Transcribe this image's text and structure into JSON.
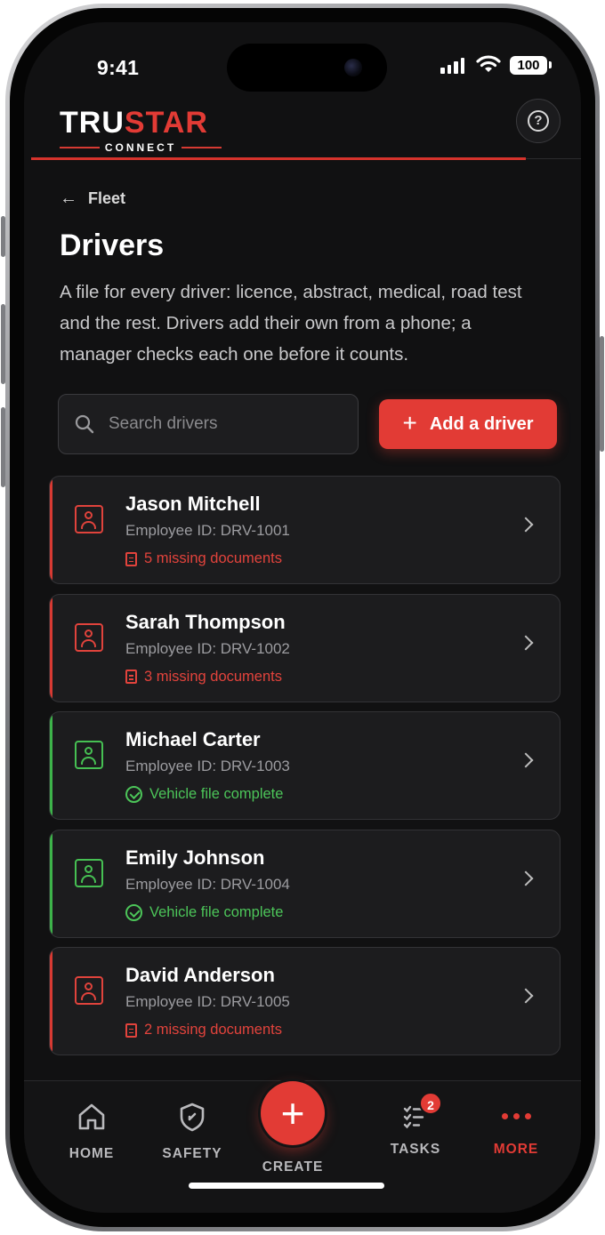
{
  "status_bar": {
    "time": "9:41",
    "battery": "100"
  },
  "brand": {
    "name_white": "TRU",
    "name_red": "STAR",
    "sub": "CONNECT"
  },
  "header": {
    "help_label": "?"
  },
  "breadcrumb": {
    "back_label": "Fleet"
  },
  "page": {
    "title": "Drivers",
    "description": "A file for every driver: licence, abstract, medical, road test and the rest. Drivers add their own from a phone; a manager checks each one before it counts."
  },
  "search": {
    "placeholder": "Search drivers",
    "value": ""
  },
  "actions": {
    "add_driver_label": "Add a driver"
  },
  "drivers": [
    {
      "name": "Jason Mitchell",
      "employee_id": "Employee ID: DRV-1001",
      "status_text": "5 missing documents",
      "status": "missing"
    },
    {
      "name": "Sarah Thompson",
      "employee_id": "Employee ID: DRV-1002",
      "status_text": "3 missing documents",
      "status": "missing"
    },
    {
      "name": "Michael Carter",
      "employee_id": "Employee ID: DRV-1003",
      "status_text": "Vehicle file complete",
      "status": "complete"
    },
    {
      "name": "Emily Johnson",
      "employee_id": "Employee ID: DRV-1004",
      "status_text": "Vehicle file complete",
      "status": "complete"
    },
    {
      "name": "David Anderson",
      "employee_id": "Employee ID: DRV-1005",
      "status_text": "2 missing documents",
      "status": "missing"
    }
  ],
  "nav": {
    "home": "HOME",
    "safety": "SAFETY",
    "create": "CREATE",
    "tasks": "TASKS",
    "tasks_badge": "2",
    "more": "MORE"
  },
  "colors": {
    "accent": "#e23b35",
    "complete": "#46c053",
    "background": "#111112",
    "card": "#1c1c1e"
  }
}
